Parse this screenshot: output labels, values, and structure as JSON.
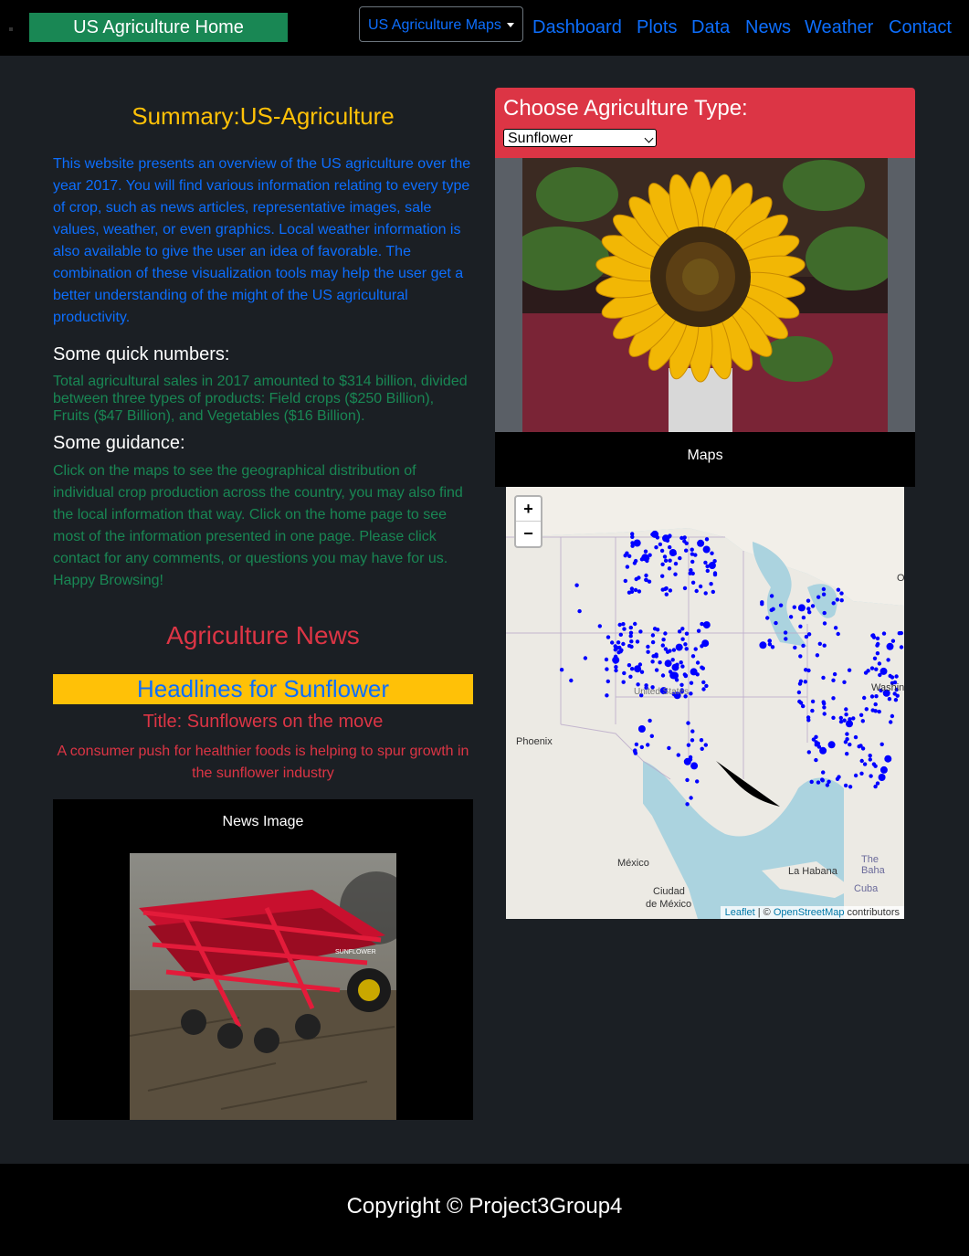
{
  "nav": {
    "brand": "US Agriculture Home",
    "maps_dropdown": "US Agriculture Maps",
    "links": [
      "Dashboard",
      "Plots",
      "Data",
      "News",
      "Weather",
      "Contact"
    ]
  },
  "summary": {
    "title": "Summary:US-Agriculture",
    "intro": "This website presents an overview of the US agriculture over the year 2017. You will find various information relating to every type of crop, such as news articles, representative images, sale values, weather, or even graphics. Local weather information is also available to give the user an idea of favorable. The combination of these visualization tools may help the user get a better understanding of the might of the US agricultural productivity.",
    "quick_heading": "Some quick numbers:",
    "quick_text": "Total agricultural sales in 2017 amounted to $314 billion, divided between three types of products: Field crops ($250 Billion), Fruits ($47 Billion), and Vegetables ($16 Billion).",
    "guidance_heading": "Some guidance:",
    "guidance_text": "Click on the maps to see the geographical distribution of individual crop production across the country, you may also find the local information that way. Click on the home page to see most of the information presented in one page. Please click contact for any comments, or questions you may have for us. Happy Browsing!"
  },
  "news": {
    "section_title": "Agriculture News",
    "headline": "Headlines for Sunflower",
    "article_title": "Title: Sunflowers on the move",
    "article_desc": "A consumer push for healthier foods is helping to spur growth in the sunflower industry",
    "image_caption": "News Image"
  },
  "selector": {
    "label": "Choose Agriculture Type:",
    "selected": "Sunflower"
  },
  "maps": {
    "caption": "Maps",
    "zoom_in": "+",
    "zoom_out": "−",
    "labels": {
      "phoenix": "Phoenix",
      "united_states": "United States",
      "mexico": "México",
      "ciudad": "Ciudad",
      "de_mexico": "de México",
      "la_habana": "La Habana",
      "cuba": "Cuba",
      "the_bahamas": "The Baha",
      "washington": "Washin",
      "ottawa": "O"
    },
    "attribution": {
      "leaflet": "Leaflet",
      "sep": " | © ",
      "osm": "OpenStreetMap",
      "contrib": " contributors"
    },
    "marker_color": "#0000ff"
  },
  "footer": {
    "copyright": "Copyright © Project3Group4"
  }
}
